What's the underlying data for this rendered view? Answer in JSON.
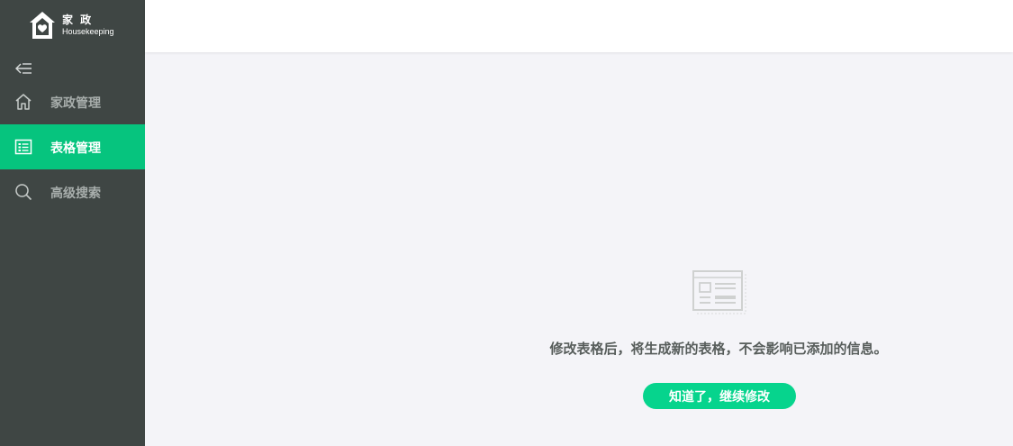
{
  "brand": {
    "name_cn": "家 政",
    "name_en": "Housekeeping"
  },
  "sidebar": {
    "collapse_icon": "collapse-menu-icon",
    "items": [
      {
        "label": "家政管理",
        "icon": "home-icon",
        "active": false
      },
      {
        "label": "表格管理",
        "icon": "table-list-icon",
        "active": true
      },
      {
        "label": "高级搜索",
        "icon": "search-icon",
        "active": false
      }
    ]
  },
  "main": {
    "empty_icon": "document-card-icon",
    "message": "修改表格后，将生成新的表格，不会影响已添加的信息。",
    "confirm_label": "知道了，继续修改"
  },
  "colors": {
    "sidebar_bg": "#3f4644",
    "accent": "#06c47e",
    "button": "#06d48d",
    "content_bg": "#f4f4f8"
  }
}
